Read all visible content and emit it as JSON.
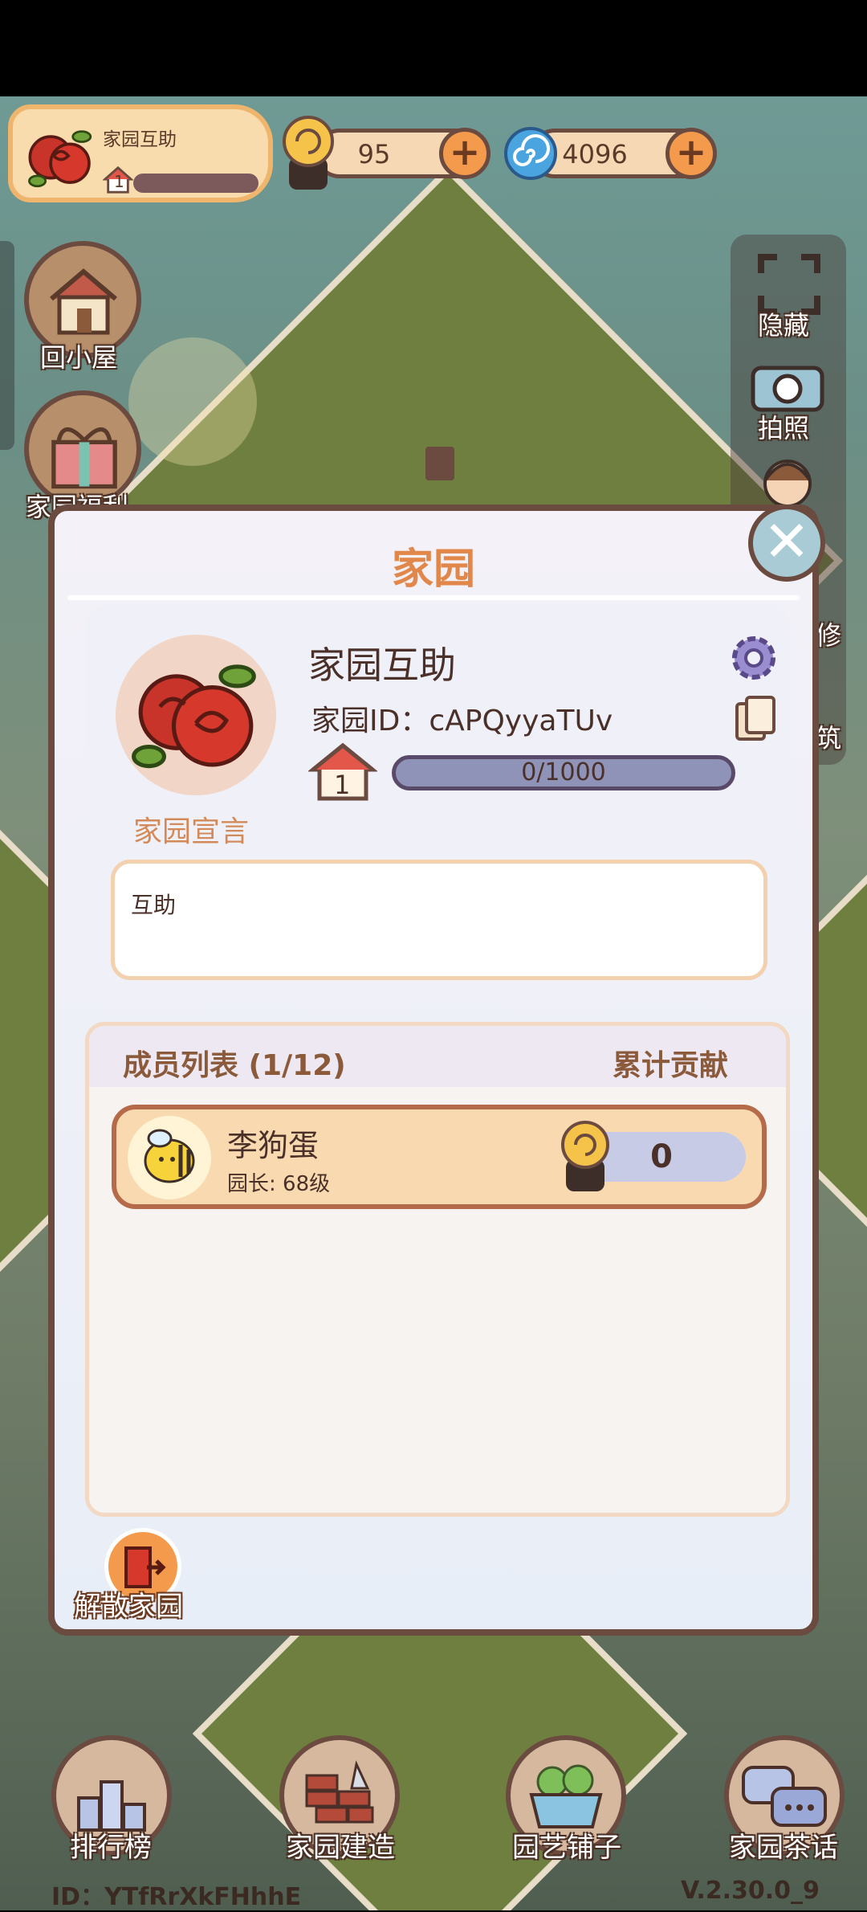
{
  "hud": {
    "home_name": "家园互助",
    "home_level": "1",
    "snail_coins": "95",
    "spiral_coins": "4096",
    "plus_label": "+"
  },
  "side_left": {
    "back_home": "回小屋",
    "home_welfare": "家园福利"
  },
  "side_right": {
    "hide": "隐藏",
    "photo": "拍照",
    "decorate": "修",
    "build": "筑"
  },
  "modal": {
    "title": "家园",
    "home_name": "家园互助",
    "home_id": "家园ID：cAPQyyaTUv",
    "level": "1",
    "exp": "0/1000",
    "declaration_label": "家园宣言",
    "declaration_text": "互助",
    "members_title": "成员列表 (1/12)",
    "contribution_title": "累计贡献",
    "members": [
      {
        "name": "李狗蛋",
        "role": "园长: 68级",
        "contribution": "0"
      }
    ],
    "dissolve_label": "解散家园",
    "close_label": "✕"
  },
  "bottom_nav": [
    {
      "label": "排行榜",
      "icon": "trophy-podium-icon"
    },
    {
      "label": "家园建造",
      "icon": "brick-trowel-icon"
    },
    {
      "label": "园艺铺子",
      "icon": "flower-basket-icon"
    },
    {
      "label": "家园茶话",
      "icon": "chat-bubbles-icon"
    }
  ],
  "footer": {
    "uid": "ID：YTfRrXkFHhhE",
    "version": "V.2.30.0_9"
  },
  "colors": {
    "accent": "#e1874a",
    "border": "#6b4a3f",
    "exp_bar": "#9093b8"
  }
}
